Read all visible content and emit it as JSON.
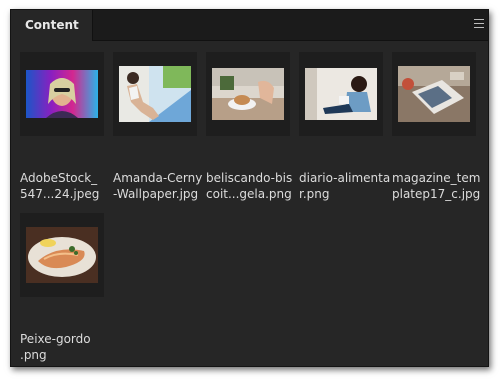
{
  "panel": {
    "tab_label": "Content",
    "menu_icon": "hamburger-menu-icon"
  },
  "files": [
    {
      "line1": "AdobeStock_",
      "line2": "547...24.jpeg"
    },
    {
      "line1": "Amanda-Cerny",
      "line2": "-Wallpaper.jpg"
    },
    {
      "line1": "beliscando-bis",
      "line2": "coit...gela.png"
    },
    {
      "line1": "diario-alimenta",
      "line2": "r.png"
    },
    {
      "line1": "magazine_tem",
      "line2": "platep17_c.jpg"
    },
    {
      "line1": "Peixe-gordo",
      "line2": ".png"
    }
  ]
}
